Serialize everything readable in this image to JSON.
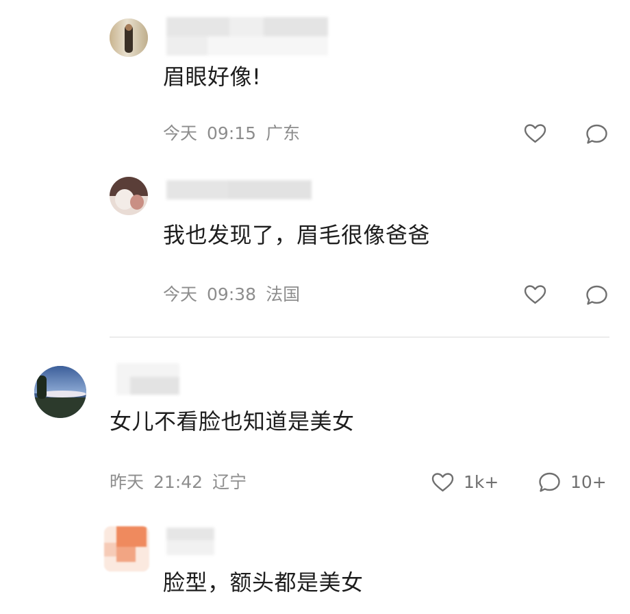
{
  "comments": [
    {
      "text": "眉眼好像!",
      "date": "今天",
      "time": "09:15",
      "location": "广东",
      "like_count": "",
      "reply_count": ""
    },
    {
      "text": "我也发现了，眉毛很像爸爸",
      "date": "今天",
      "time": "09:38",
      "location": "法国",
      "like_count": "",
      "reply_count": ""
    },
    {
      "text": "女儿不看脸也知道是美女",
      "date": "昨天",
      "time": "21:42",
      "location": "辽宁",
      "like_count": "1k+",
      "reply_count": "10+"
    },
    {
      "text": "脸型，额头都是美女"
    }
  ],
  "icons": {
    "like": "heart-outline-icon",
    "reply": "speech-bubble-icon"
  },
  "colors": {
    "text": "#1d1d1d",
    "meta": "#8d8d8d",
    "icon": "#6f6f6f",
    "divider": "#ececec"
  }
}
